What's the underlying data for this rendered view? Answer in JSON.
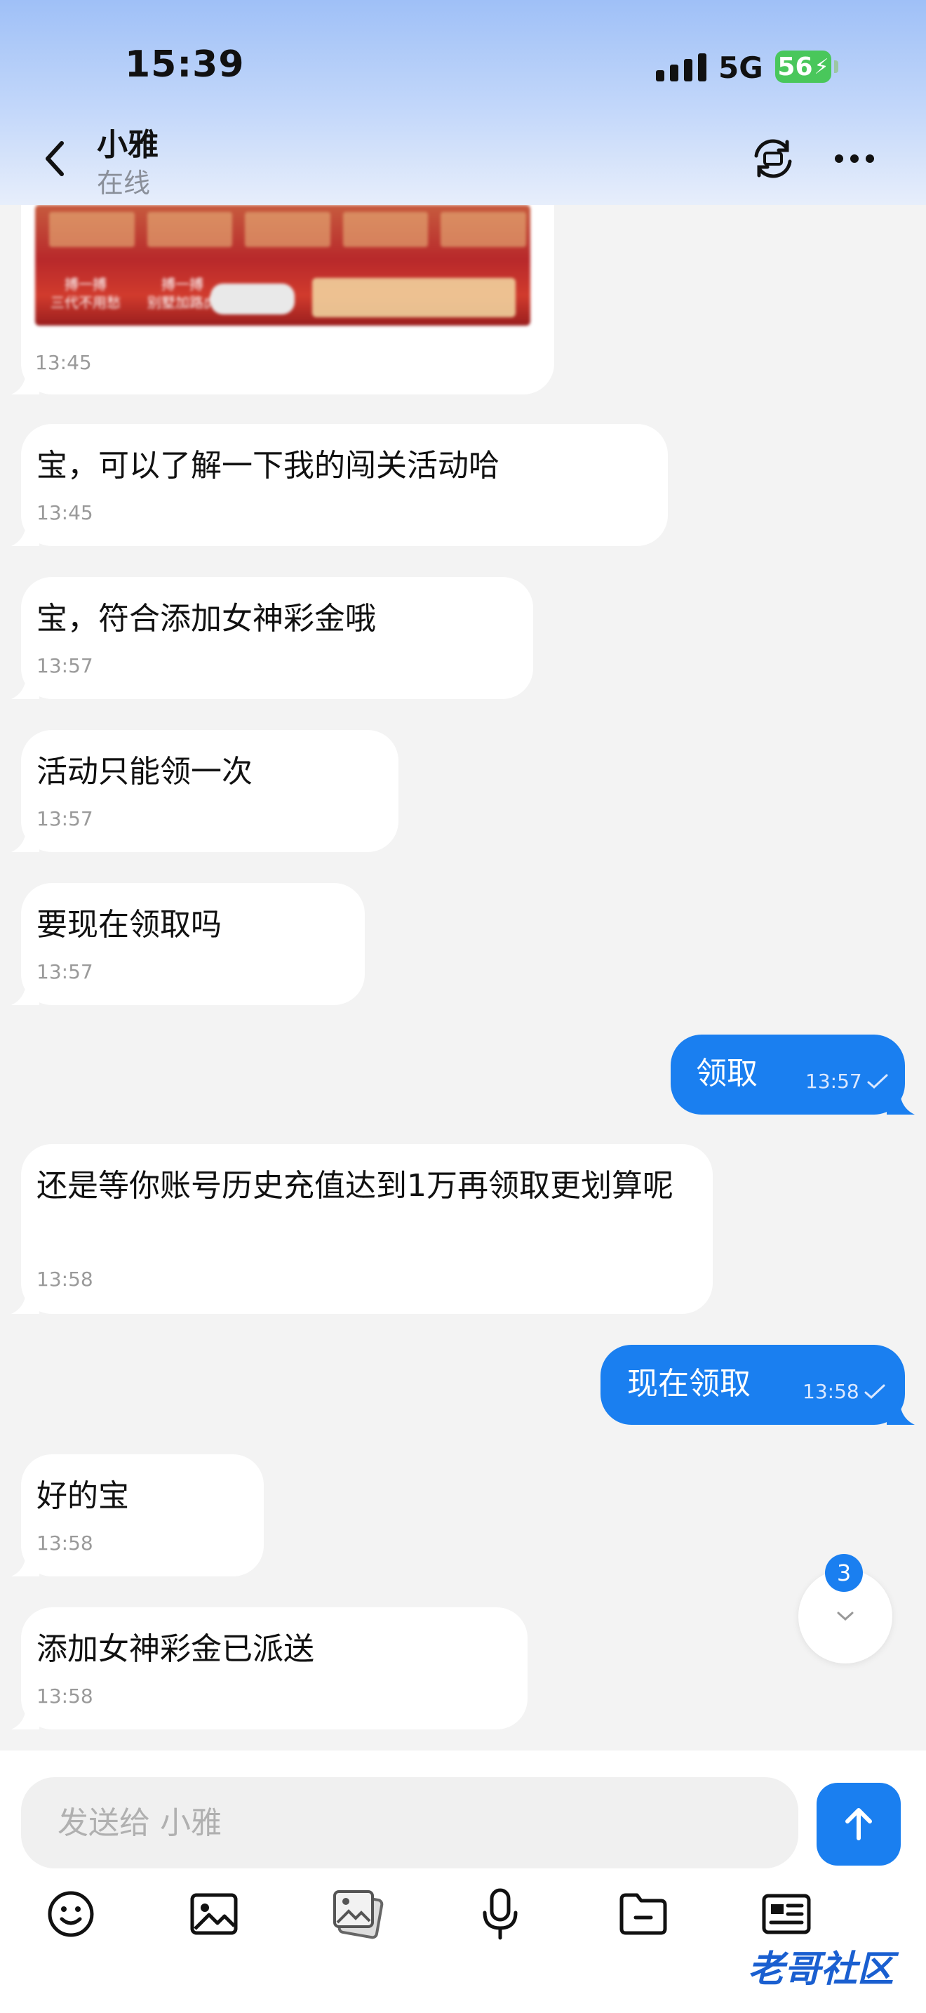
{
  "status_bar": {
    "time": "15:39",
    "network": "5G",
    "battery": "56"
  },
  "header": {
    "contact_name": "小雅",
    "contact_status": "在线"
  },
  "messages": [
    {
      "dir": "in",
      "time": "13:45"
    },
    {
      "dir": "in",
      "text": "宝，可以了解一下我的闯关活动哈",
      "time": "13:45"
    },
    {
      "dir": "in",
      "text": "宝，符合添加女神彩金哦",
      "time": "13:57"
    },
    {
      "dir": "in",
      "text": "活动只能领一次",
      "time": "13:57"
    },
    {
      "dir": "in",
      "text": "要现在领取吗",
      "time": "13:57"
    },
    {
      "dir": "out",
      "text": "领取",
      "time": "13:57"
    },
    {
      "dir": "in",
      "text": "还是等你账号历史充值达到1万再领取更划算呢",
      "time": "13:58"
    },
    {
      "dir": "out",
      "text": "现在领取",
      "time": "13:58"
    },
    {
      "dir": "in",
      "text": "好的宝",
      "time": "13:58"
    },
    {
      "dir": "in",
      "text": "添加女神彩金已派送",
      "time": "13:58"
    }
  ],
  "banner": {
    "left_line1": "搏一搏",
    "left_line2": "三代不用愁",
    "mid_line1": "搏一搏",
    "mid_line2": "别墅加路虎"
  },
  "scroll_badge": {
    "count": "3"
  },
  "composer": {
    "placeholder": "发送给 小雅"
  },
  "toolbar_icons": [
    "emoji-icon",
    "image-icon",
    "gallery-icon",
    "microphone-icon",
    "folder-icon",
    "card-icon"
  ],
  "watermark": {
    "text": "老哥社区"
  },
  "colors": {
    "accent": "#1a7ff0",
    "bubble_in": "#ffffff",
    "background": "#f3f3f3",
    "battery": "#49c75b"
  }
}
